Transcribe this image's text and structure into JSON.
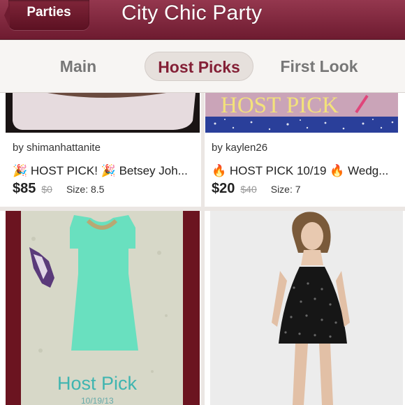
{
  "header": {
    "back_label": "Parties",
    "title": "City Chic Party"
  },
  "tabs": [
    {
      "label": "Main"
    },
    {
      "label": "Host Picks"
    },
    {
      "label": "First Look"
    }
  ],
  "listings": [
    {
      "seller": "by shimanhattanite",
      "title_prefix": "🎉",
      "title_main": "HOST PICK!",
      "title_suffix": "🎉 Betsey Joh...",
      "price": "$85",
      "original_price": "$0",
      "size": "Size: 8.5"
    },
    {
      "seller": "by kaylen26",
      "title_prefix": "🔥",
      "title_main": "HOST PICK 10/19",
      "title_suffix": "🔥 Wedg...",
      "price": "$20",
      "original_price": "$40",
      "size": "Size: 7",
      "image_text": "HOST PICK"
    },
    {
      "image_text": "Host Pick",
      "image_subtext": "10/19/13"
    },
    {}
  ],
  "colors": {
    "brand": "#842036",
    "header": "#7a2138",
    "teal_text": "#3fb5b0"
  }
}
